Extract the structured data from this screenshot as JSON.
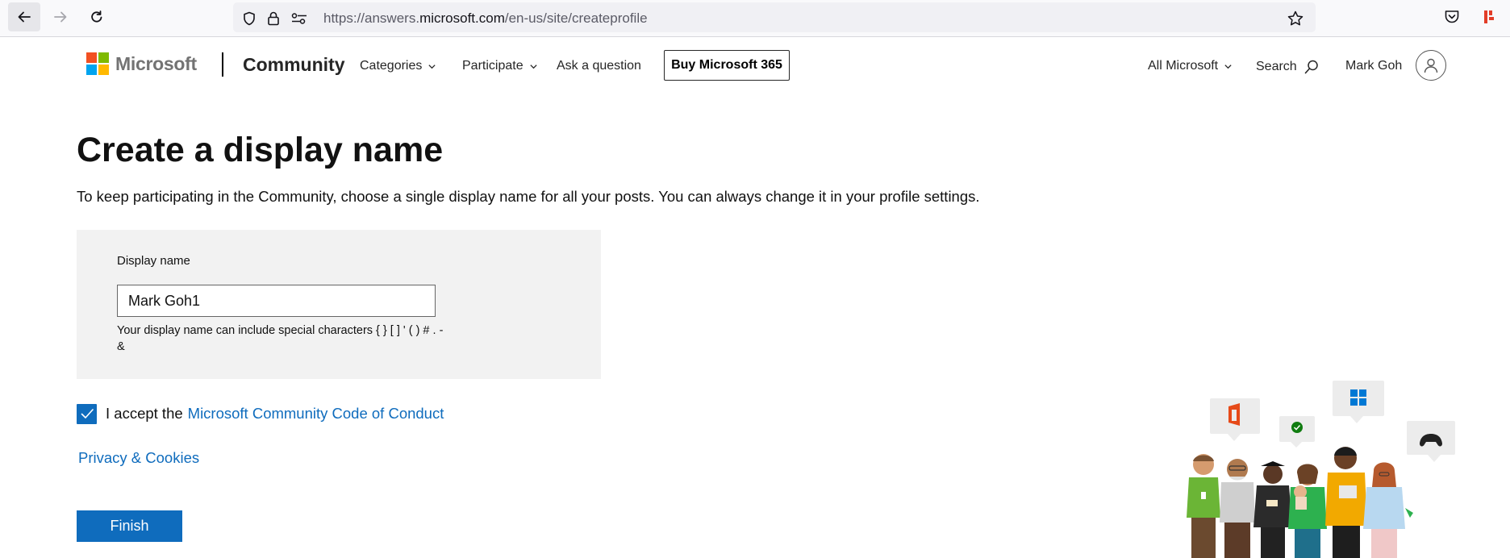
{
  "browser": {
    "url_prefix": "https://answers.",
    "url_host": "microsoft.com",
    "url_path": "/en-us/site/createprofile",
    "icons": [
      "back-icon",
      "forward-icon",
      "reload-icon",
      "shield-icon",
      "lock-icon",
      "permissions-icon",
      "bookmark-star-icon",
      "pocket-icon",
      "extension-icon"
    ]
  },
  "header": {
    "brand": "Microsoft",
    "site_name": "Community",
    "nav": {
      "categories": "Categories",
      "participate": "Participate",
      "ask": "Ask a question"
    },
    "buy_button": "Buy Microsoft 365",
    "all_microsoft": "All Microsoft",
    "search": "Search",
    "user_name": "Mark Goh",
    "logo_colors": [
      "#f25022",
      "#7fba00",
      "#00a4ef",
      "#ffb900"
    ]
  },
  "main": {
    "title": "Create a display name",
    "description": "To keep participating in the Community, choose a single display name for all your posts. You can always change it in your profile settings.",
    "form": {
      "label": "Display name",
      "value": "Mark Goh1",
      "hint": "Your display name can include special characters { } [ ] ' ( ) # . - &"
    },
    "accept": {
      "checked": true,
      "text": "I accept the",
      "link": "Microsoft Community Code of Conduct"
    },
    "privacy_link": "Privacy & Cookies",
    "finish_button": "Finish"
  },
  "colors": {
    "accent": "#0f6cbd",
    "panel": "#f2f2f2"
  }
}
